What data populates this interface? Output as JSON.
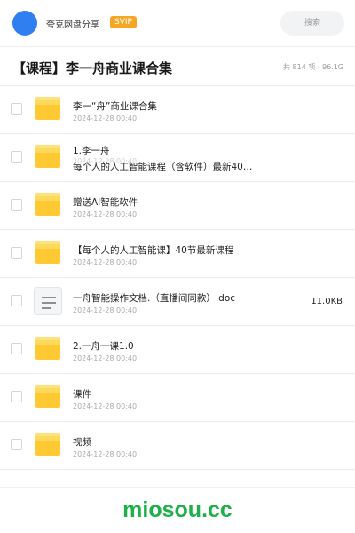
{
  "header": {
    "app_name": "夸克网盘分享",
    "badge": "SVIP",
    "search_label": "搜索"
  },
  "folder": {
    "title": "【课程】李一舟商业课合集",
    "summary": "共 814 项 · 96.1G"
  },
  "items": [
    {
      "name": "李一“舟”商业课合集",
      "date": "2024-12-28 00:40",
      "icon": "folder-icon"
    },
    {
      "name_line1": "1.李一舟",
      "name_line2": "每个人的人工智能课程（含软件）最新40…",
      "date": "2024-12-28 00:40",
      "icon": "folder-icon"
    },
    {
      "name": "赠送AI智能软件",
      "date": "2024-12-28 00:40",
      "icon": "folder-icon"
    },
    {
      "name": "【每个人的人工智能课】40节最新课程",
      "date": "2024-12-28 00:40",
      "icon": "folder-icon"
    },
    {
      "name": "一舟智能操作文档.（直播间同款）.doc",
      "date": "2024-12-28 00:40",
      "size": "11.0KB",
      "icon": "doc-file-icon"
    },
    {
      "name": "2.一舟一课1.0",
      "date": "2024-12-28 00:40",
      "icon": "folder-icon"
    },
    {
      "name": "课件",
      "date": "2024-12-28 00:40",
      "icon": "folder-icon"
    },
    {
      "name": "视频",
      "date": "2024-12-28 00:40",
      "icon": "folder-icon"
    }
  ],
  "watermark": "miosou.cc",
  "colors": {
    "accent": "#2f7ff0",
    "svip": "#f5a623",
    "folder": "#ffc933",
    "watermark": "#1fb04a"
  }
}
